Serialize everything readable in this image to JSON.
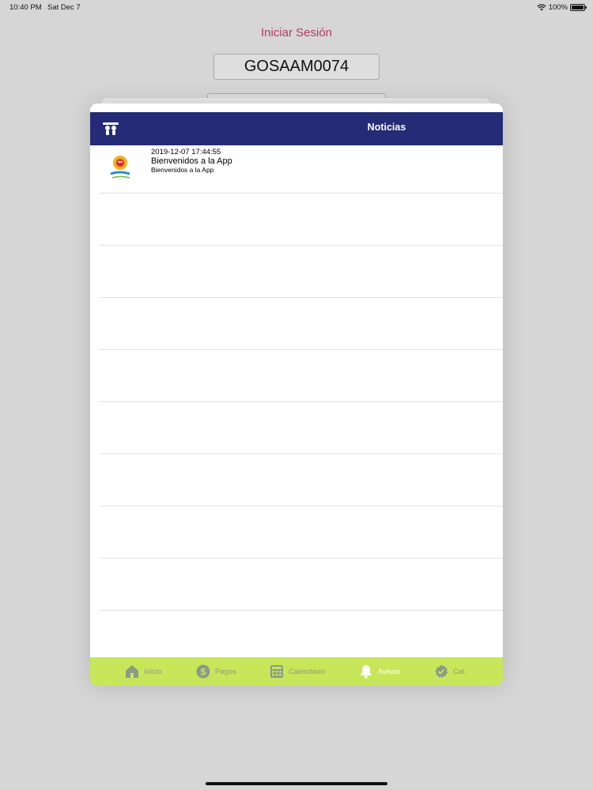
{
  "status_bar": {
    "time": "10:40 PM",
    "date": "Sat Dec 7",
    "battery": "100%",
    "battery_level": 1.0
  },
  "background": {
    "login_title": "Iniciar Sesión",
    "username": "GOSAAM0074"
  },
  "nav": {
    "title": "Noticias",
    "left_icon": "people-icon",
    "bar_color": "#252b76"
  },
  "news": [
    {
      "date": "2019-12-07 17:44:55",
      "title": "Bienvenidos a la App",
      "subtitle": "Bienvenidos a la App",
      "logo": "discovery-logo"
    }
  ],
  "tab_bar": {
    "color": "#c8e65a",
    "tabs": [
      {
        "label": "Inicio",
        "icon": "home-icon",
        "active": false
      },
      {
        "label": "Pagos",
        "icon": "dollar-icon",
        "active": false
      },
      {
        "label": "Calendario",
        "icon": "calendar-icon",
        "active": false
      },
      {
        "label": "Avisos",
        "icon": "bell-icon",
        "active": true
      },
      {
        "label": "Cal.",
        "icon": "check-badge-icon",
        "active": false
      }
    ]
  },
  "colors": {
    "accent": "#b13b63",
    "nav": "#252b76",
    "tab_bar": "#c8e65a"
  }
}
